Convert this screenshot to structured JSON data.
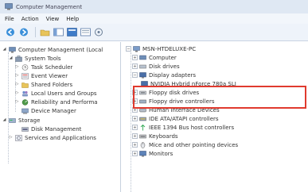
{
  "window": {
    "title": "Computer Management"
  },
  "menu": {
    "items": [
      "File",
      "Action",
      "View",
      "Help"
    ]
  },
  "toolbar": {
    "icons": [
      "back-icon",
      "forward-icon",
      "up-folder-icon",
      "show-hide-tree-icon",
      "properties-icon",
      "help-icon",
      "console-icon"
    ]
  },
  "left_tree": {
    "items": [
      {
        "label": "Computer Management (Local",
        "level": 0,
        "expander": "expanded"
      },
      {
        "label": "System Tools",
        "level": 1,
        "expander": "expanded"
      },
      {
        "label": "Task Scheduler",
        "level": 2,
        "expander": "collapsed"
      },
      {
        "label": "Event Viewer",
        "level": 2,
        "expander": "collapsed"
      },
      {
        "label": "Shared Folders",
        "level": 2,
        "expander": "collapsed"
      },
      {
        "label": "Local Users and Groups",
        "level": 2,
        "expander": "collapsed"
      },
      {
        "label": "Reliability and Performa",
        "level": 2,
        "expander": "collapsed"
      },
      {
        "label": "Device Manager",
        "level": 2,
        "expander": "none"
      },
      {
        "label": "Storage",
        "level": 1,
        "expander": "expanded"
      },
      {
        "label": "Disk Management",
        "level": 2,
        "expander": "none"
      },
      {
        "label": "Services and Applications",
        "level": 1,
        "expander": "collapsed"
      }
    ]
  },
  "device_tree": {
    "root": "MSN-HTDELUXE-PC",
    "items": [
      {
        "label": "Computer",
        "level": 1,
        "expander": "collapsed"
      },
      {
        "label": "Disk drives",
        "level": 1,
        "expander": "collapsed"
      },
      {
        "label": "Display adapters",
        "level": 1,
        "expander": "expanded"
      },
      {
        "label": "NVIDIA Hybrid nForce 780a SLI",
        "level": 2,
        "expander": "none"
      },
      {
        "label": "Floppy disk drives",
        "level": 1,
        "expander": "collapsed"
      },
      {
        "label": "Floppy drive controllers",
        "level": 1,
        "expander": "collapsed"
      },
      {
        "label": "Human Interface Devices",
        "level": 1,
        "expander": "collapsed"
      },
      {
        "label": "IDE ATA/ATAPI controllers",
        "level": 1,
        "expander": "collapsed"
      },
      {
        "label": "IEEE 1394 Bus host controllers",
        "level": 1,
        "expander": "collapsed"
      },
      {
        "label": "Keyboards",
        "level": 1,
        "expander": "collapsed"
      },
      {
        "label": "Mice and other pointing devices",
        "level": 1,
        "expander": "collapsed"
      },
      {
        "label": "Monitors",
        "level": 1,
        "expander": "collapsed"
      }
    ]
  },
  "colors": {
    "highlight_box": "#e03a2e",
    "titlebar": "#dfe8f3",
    "toolbar": "#eef3fa"
  }
}
